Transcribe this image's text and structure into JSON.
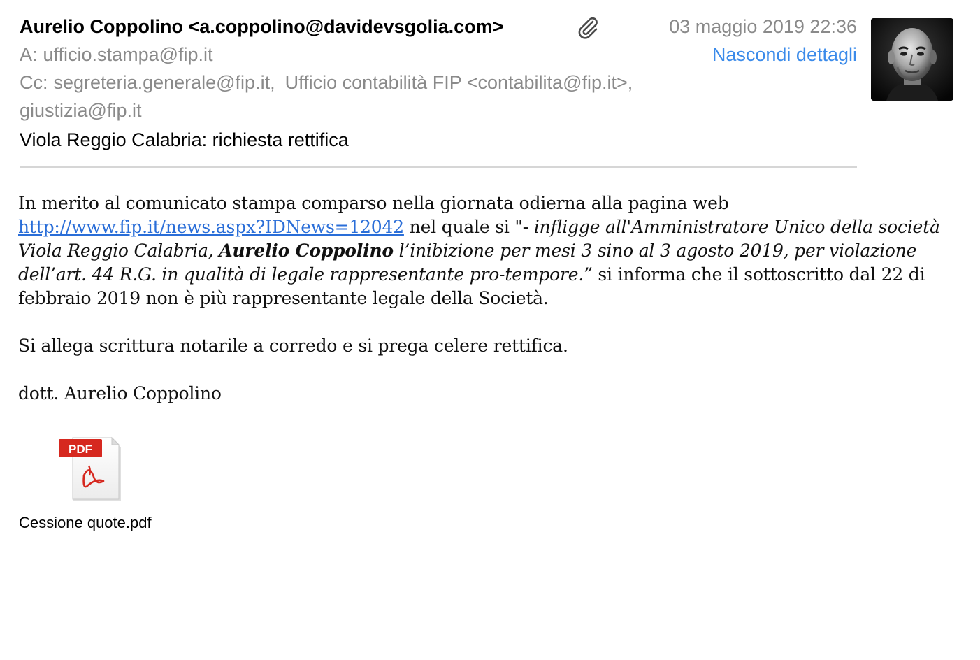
{
  "header": {
    "from": "Aurelio Coppolino <a.coppolino@davidevsgolia.com>",
    "date": "03 maggio 2019 22:36",
    "to_label": "A:",
    "to": "ufficio.stampa@fip.it",
    "hide_details": "Nascondi dettagli",
    "cc_label": "Cc:",
    "cc_1": "segreteria.generale@fip.it,",
    "cc_2": "Ufficio contabilità FIP <contabilita@fip.it>,",
    "cc_3": "giustizia@fip.it",
    "subject": "Viola Reggio Calabria: richiesta rettifica",
    "attachment_icon": "paperclip-icon",
    "avatar": "sender-avatar"
  },
  "body": {
    "p1_start": "In merito al comunicato stampa comparso nella giornata odierna alla pagina web ",
    "link": "http://www.fip.it/news.aspx?IDNews=12042",
    "p1_mid": " nel quale si \"- ",
    "quote_1": "infligge all'Amministratore Unico della società Viola Reggio Calabria, ",
    "quote_name": "Aurelio Coppolino",
    "quote_2": " l’inibizione per mesi 3 sino al 3 agosto 2019, per violazione dell’art. 44 R.G. in qualità di legale rappresentante pro-tempore.”",
    "p1_end": " si informa che il sottoscritto dal 22 di febbraio 2019 non è più rappresentante legale della Società.",
    "p2": "Si allega scrittura notarile a corredo e si prega celere rettifica.",
    "signature": "dott. Aurelio Coppolino"
  },
  "attachment": {
    "badge": "PDF",
    "filename": "Cessione quote.pdf",
    "icon": "pdf-file-icon"
  },
  "colors": {
    "link": "#2a6ed8",
    "accent_blue": "#3b8bea",
    "header_gray": "#8a8a8a",
    "pdf_red": "#d6281f"
  }
}
